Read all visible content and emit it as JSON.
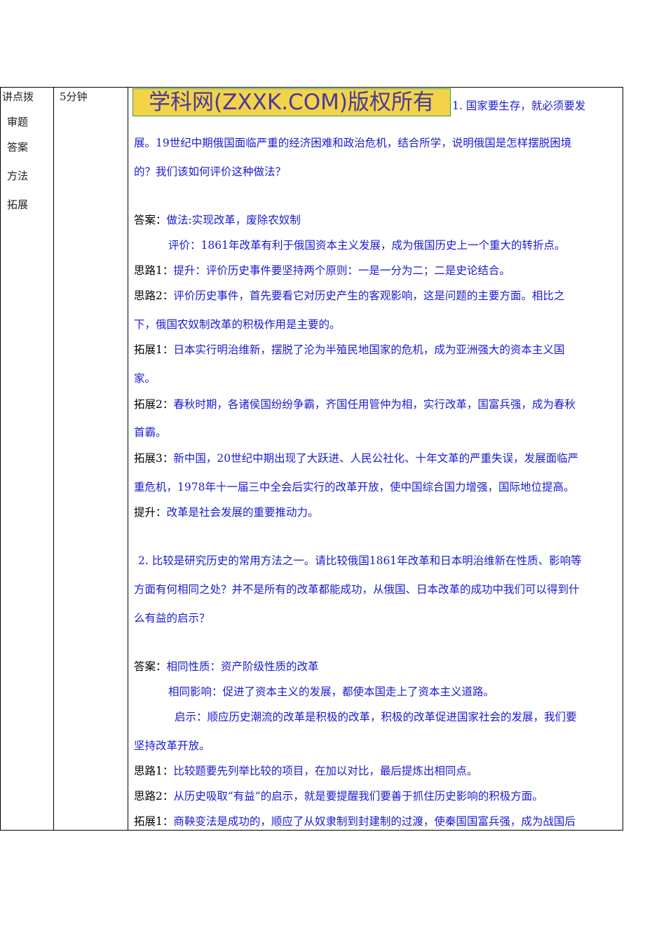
{
  "left_col": [
    "讲点拨",
    "审题",
    "答案",
    "方法",
    "拓展"
  ],
  "time": "5分钟",
  "watermark": "学科网(ZXXK.COM)版权所有",
  "lines": [
    {
      "label": "",
      "text": "1. 国家要生存，就必须要发"
    },
    {
      "label": "",
      "text": "展。19世纪中期俄国面临严重的经济困难和政治危机，结合所学，说明俄国是怎样摆脱困境"
    },
    {
      "label": "",
      "text": "的？我们该如何评价这种做法？"
    },
    {
      "label": "答案：",
      "text": "做法:实现改革，废除农奴制"
    },
    {
      "label": "",
      "text": "评价：1861年改革有利于俄国资本主义发展，成为俄国历史上一个重大的转折点。"
    },
    {
      "label": "思路1：",
      "text": "提升：评价历史事件要坚持两个原则：一是一分为二；二是史论结合。"
    },
    {
      "label": "思路2：",
      "text": "评价历史事件，首先要看它对历史产生的客观影响，这是问题的主要方面。相比之"
    },
    {
      "label": "",
      "text": "下，俄国农奴制改革的积极作用是主要的。"
    },
    {
      "label": "拓展1：",
      "text": "日本实行明治维新，摆脱了沦为半殖民地国家的危机，成为亚洲强大的资本主义国"
    },
    {
      "label": "",
      "text": "家。"
    },
    {
      "label": "拓展2：",
      "text": "春秋时期，各诸侯国纷纷争霸，齐国任用管仲为相，实行改革，国富兵强，成为春秋"
    },
    {
      "label": "",
      "text": "首霸。"
    },
    {
      "label": "拓展3：",
      "text": "新中国，20世纪中期出现了大跃进、人民公社化、十年文革的严重失误，发展面临严"
    },
    {
      "label": "",
      "text": "重危机，1978年十一届三中全会后实行的改革开放，使中国综合国力增强，国际地位提高。"
    },
    {
      "label": "提升：",
      "text": "改革是社会发展的重要推动力。"
    },
    {
      "label": "",
      "text": "2. 比较是研究历史的常用方法之一。请比较俄国1861年改革和日本明治维新在性质、影响等"
    },
    {
      "label": "",
      "text": "方面有何相同之处？并不是所有的改革都能成功，从俄国、日本改革的成功中我们可以得到什"
    },
    {
      "label": "",
      "text": "么有益的启示？"
    },
    {
      "label": "答案：",
      "text": "相同性质：资产阶级性质的改革"
    },
    {
      "label": "",
      "text": "相同影响：促进了资本主义的发展，都使本国走上了资本主义道路。"
    },
    {
      "label": "",
      "text": "启示：顺应历史潮流的改革是积极的改革，积极的改革促进国家社会的发展，我们要"
    },
    {
      "label": "",
      "text": "坚持改革开放。"
    },
    {
      "label": "思路1：",
      "text": "比较题要先列举比较的项目，在加以对比，最后提炼出相同点。"
    },
    {
      "label": "思路2：",
      "text": "从历史吸取“有益”的启示，就是要提醒我们要善于抓住历史影响的积极方面。"
    },
    {
      "label": "拓展1：",
      "text": "商鞅变法是成功的，顺应了从奴隶制到封建制的过渡，使秦国国富兵强，成为战国后"
    }
  ]
}
